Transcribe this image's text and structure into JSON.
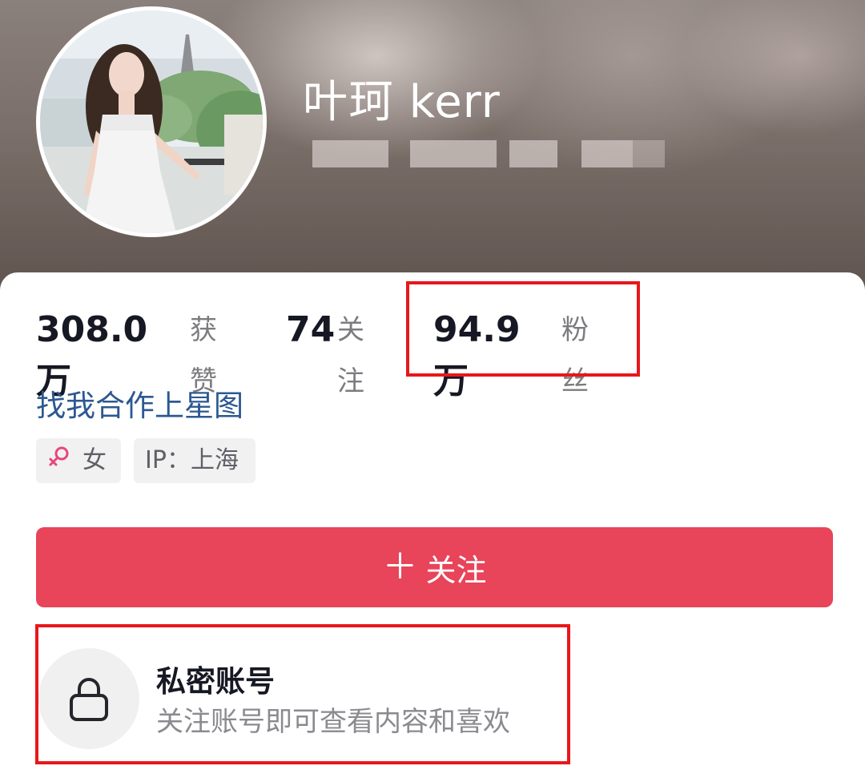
{
  "profile": {
    "name": "叶珂 kerr"
  },
  "stats": {
    "likes_value": "308.0万",
    "likes_label": "获赞",
    "following_value": "74",
    "following_label": "关注",
    "followers_value": "94.9万",
    "followers_label": "粉丝"
  },
  "collab_link": "找我合作上星图",
  "tags": {
    "gender_label": "女",
    "gender_icon": "female-symbol-icon",
    "ip_label": "IP：上海"
  },
  "follow_button": {
    "icon": "plus-icon",
    "label": "关注"
  },
  "private_account": {
    "icon": "lock-icon",
    "title": "私密账号",
    "subtitle": "关注账号即可查看内容和喜欢"
  },
  "colors": {
    "follow_button": "#e8445a",
    "link": "#2c5891",
    "highlight_box": "#e8171a",
    "female_icon": "#e8467c"
  }
}
